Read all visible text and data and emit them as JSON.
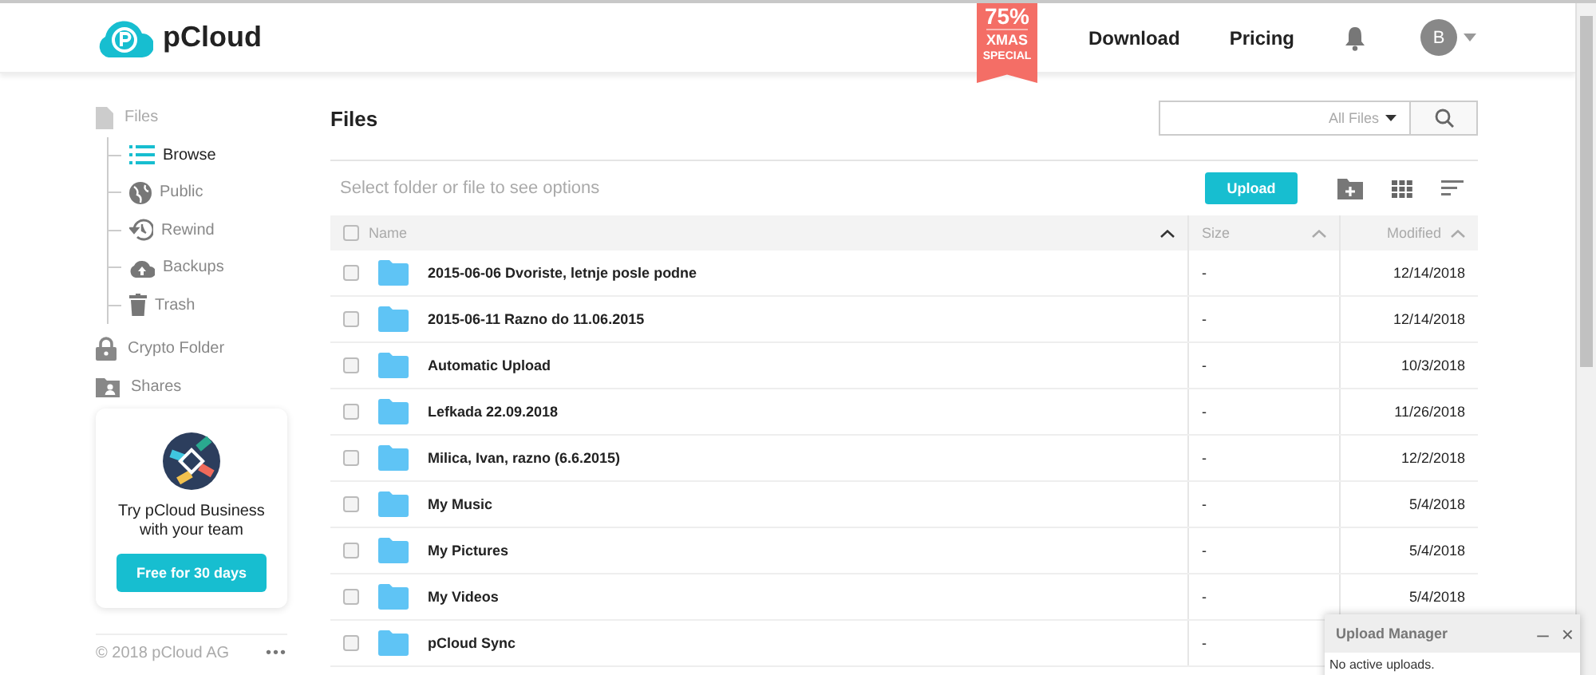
{
  "header": {
    "logo": "pCloud",
    "promo": {
      "percent": "75%",
      "line1": "XMAS",
      "line2": "SPECIAL"
    },
    "nav": [
      "Download",
      "Pricing"
    ],
    "avatar": "B"
  },
  "sidebar": {
    "section": {
      "label": "Files",
      "children": [
        {
          "label": "Browse",
          "kind": "list",
          "selected": true
        },
        {
          "label": "Public",
          "kind": "globe",
          "selected": false
        },
        {
          "label": "Rewind",
          "kind": "clock",
          "selected": false
        },
        {
          "label": "Backups",
          "kind": "cloud",
          "selected": false
        },
        {
          "label": "Trash",
          "kind": "trash",
          "selected": false
        }
      ]
    },
    "items": [
      {
        "label": "Crypto Folder",
        "kind": "lock",
        "selected": false
      },
      {
        "label": "Shares",
        "kind": "share",
        "selected": false
      }
    ],
    "promo_card": {
      "text": "Try pCloud Business with your team",
      "button": "Free for 30 days"
    },
    "footer": "© 2018 pCloud AG",
    "more": "•••"
  },
  "main": {
    "title": "Files",
    "search": {
      "scope": "All Files"
    },
    "hint": "Select folder or file to see options",
    "upload": "Upload",
    "table": {
      "select_all": {
        "checked": false
      },
      "columns": [
        "Name",
        "Size",
        "Modified"
      ],
      "rows": [
        {
          "name": "2015-06-06 Dvoriste, letnje posle podne",
          "size": "-",
          "modified": "12/14/2018",
          "checked": false
        },
        {
          "name": "2015-06-11 Razno do 11.06.2015",
          "size": "-",
          "modified": "12/14/2018",
          "checked": false
        },
        {
          "name": "Automatic Upload",
          "size": "-",
          "modified": "10/3/2018",
          "checked": false
        },
        {
          "name": "Lefkada 22.09.2018",
          "size": "-",
          "modified": "11/26/2018",
          "checked": false
        },
        {
          "name": "Milica, Ivan, razno (6.6.2015)",
          "size": "-",
          "modified": "12/2/2018",
          "checked": false
        },
        {
          "name": "My Music",
          "size": "-",
          "modified": "5/4/2018",
          "checked": false
        },
        {
          "name": "My Pictures",
          "size": "-",
          "modified": "5/4/2018",
          "checked": false
        },
        {
          "name": "My Videos",
          "size": "-",
          "modified": "5/4/2018",
          "checked": false
        },
        {
          "name": "pCloud Sync",
          "size": "-",
          "checked": false
        }
      ]
    }
  },
  "upload_manager": {
    "title": "Upload Manager",
    "minimize": "–",
    "close": "×",
    "status": "No active uploads."
  }
}
